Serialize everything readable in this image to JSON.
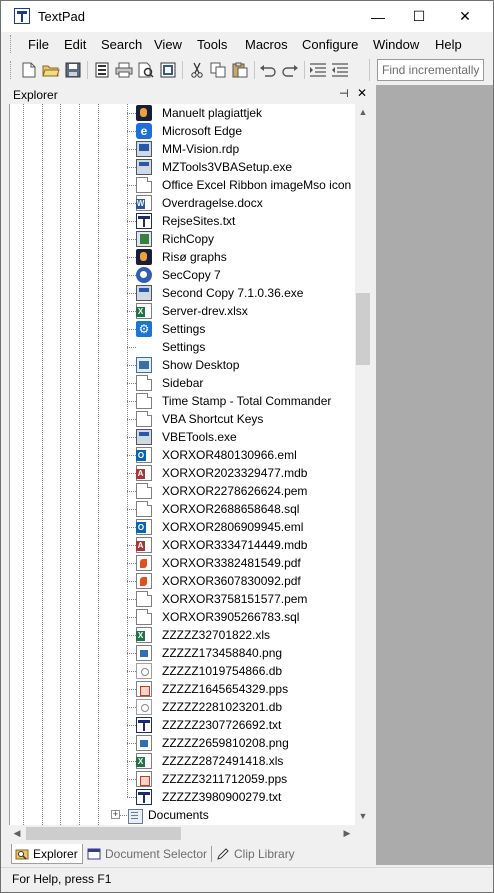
{
  "window": {
    "title": "TextPad",
    "minimize_glyph": "—",
    "maximize_glyph": "☐",
    "close_glyph": "✕"
  },
  "menu": [
    "File",
    "Edit",
    "Search",
    "View",
    "Tools",
    "Macros",
    "Configure",
    "Window",
    "Help"
  ],
  "toolbar": {
    "buttons": [
      "new-file-icon",
      "open-folder-icon",
      "save-icon",
      "document-properties-icon",
      "print-icon",
      "print-preview-icon",
      "manage-files-icon",
      "cut-icon",
      "copy-icon",
      "paste-icon",
      "undo-icon",
      "redo-icon",
      "indent-icon",
      "outdent-icon"
    ],
    "find_placeholder": "Find incrementally"
  },
  "explorer": {
    "title": "Explorer",
    "pin_glyph": "⊣",
    "close_glyph": "✕",
    "items": [
      {
        "label": "Manuelt plagiattjek",
        "icon": "app-icon"
      },
      {
        "label": "Microsoft Edge",
        "icon": "edge-icon"
      },
      {
        "label": "MM-Vision.rdp",
        "icon": "rdp-icon"
      },
      {
        "label": "MZTools3VBASetup.exe",
        "icon": "exe-icon"
      },
      {
        "label": "Office Excel Ribbon imageMso icon",
        "icon": "document-icon"
      },
      {
        "label": "Overdragelse.docx",
        "icon": "word-icon"
      },
      {
        "label": "RejseSites.txt",
        "icon": "txt-icon"
      },
      {
        "label": "RichCopy",
        "icon": "richcopy-icon"
      },
      {
        "label": "Risø graphs",
        "icon": "app-icon"
      },
      {
        "label": "SecCopy 7",
        "icon": "seccopy-icon"
      },
      {
        "label": "Second Copy 7.1.0.36.exe",
        "icon": "exe-icon"
      },
      {
        "label": "Server-drev.xlsx",
        "icon": "excel-icon"
      },
      {
        "label": "Settings",
        "icon": "gear-icon"
      },
      {
        "label": "Settings",
        "icon": "blank-icon"
      },
      {
        "label": "Show Desktop",
        "icon": "desktop-icon"
      },
      {
        "label": "Sidebar",
        "icon": "document-icon"
      },
      {
        "label": "Time Stamp - Total Commander",
        "icon": "document-icon"
      },
      {
        "label": "VBA Shortcut Keys",
        "icon": "document-icon"
      },
      {
        "label": "VBETools.exe",
        "icon": "exe-icon"
      },
      {
        "label": "XORXOR480130966.eml",
        "icon": "outlook-icon"
      },
      {
        "label": "XORXOR2023329477.mdb",
        "icon": "access-icon"
      },
      {
        "label": "XORXOR2278626624.pem",
        "icon": "document-icon"
      },
      {
        "label": "XORXOR2688658648.sql",
        "icon": "document-icon"
      },
      {
        "label": "XORXOR2806909945.eml",
        "icon": "outlook-icon"
      },
      {
        "label": "XORXOR3334714449.mdb",
        "icon": "access-icon"
      },
      {
        "label": "XORXOR3382481549.pdf",
        "icon": "pdf-icon"
      },
      {
        "label": "XORXOR3607830092.pdf",
        "icon": "pdf-icon"
      },
      {
        "label": "XORXOR3758151577.pem",
        "icon": "document-icon"
      },
      {
        "label": "XORXOR3905266783.sql",
        "icon": "document-icon"
      },
      {
        "label": "ZZZZZ32701822.xls",
        "icon": "excel-icon"
      },
      {
        "label": "ZZZZZ173458840.png",
        "icon": "png-icon"
      },
      {
        "label": "ZZZZZ1019754866.db",
        "icon": "db-icon"
      },
      {
        "label": "ZZZZZ1645654329.pps",
        "icon": "pps-icon"
      },
      {
        "label": "ZZZZZ2281023201.db",
        "icon": "db-icon"
      },
      {
        "label": "ZZZZZ2307726692.txt",
        "icon": "txt-icon"
      },
      {
        "label": "ZZZZZ2659810208.png",
        "icon": "png-icon"
      },
      {
        "label": "ZZZZZ2872491418.xls",
        "icon": "excel-icon"
      },
      {
        "label": "ZZZZZ3211712059.pps",
        "icon": "pps-icon"
      },
      {
        "label": "ZZZZZ3980900279.txt",
        "icon": "txt-icon"
      }
    ],
    "folder_item": {
      "label": "Documents",
      "expander": "+",
      "icon": "folder-icon"
    },
    "scroll": {
      "up": "▲",
      "down": "▼",
      "left": "◀",
      "right": "▶"
    }
  },
  "tabs": [
    {
      "label": "Explorer",
      "active": true
    },
    {
      "label": "Document Selector",
      "active": false
    },
    {
      "label": "Clip Library",
      "active": false
    }
  ],
  "status": {
    "text": "For Help, press F1"
  }
}
